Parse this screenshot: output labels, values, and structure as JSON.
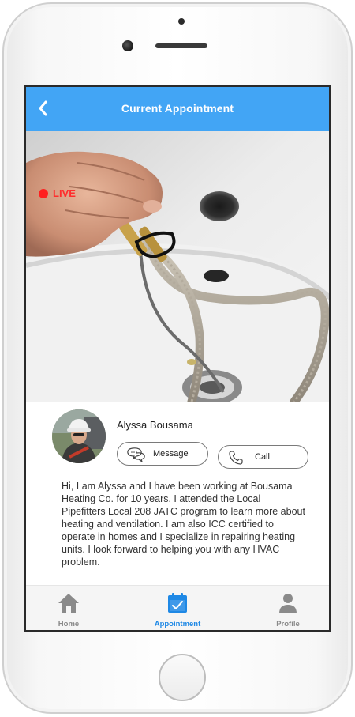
{
  "header": {
    "title": "Current Appointment"
  },
  "video": {
    "live_label": "LIVE"
  },
  "provider": {
    "name": "Alyssa Bousama",
    "message_label": "Message",
    "call_label": "Call",
    "bio": "Hi, I am Alyssa and I have been working at Bousama Heating Co. for 10 years. I attended the Local Pipefitters Local 208 JATC program to learn more about heating and ventilation. I am also ICC certified to operate in homes and I specialize in repairing heating units. I look forward to helping you with any HVAC problem."
  },
  "bottom_nav": {
    "items": [
      {
        "label": "Home",
        "icon": "home-icon",
        "active": false
      },
      {
        "label": "Appointment",
        "icon": "calendar-check-icon",
        "active": true
      },
      {
        "label": "Profile",
        "icon": "person-icon",
        "active": false
      }
    ]
  },
  "colors": {
    "brand_blue": "#42a5f5",
    "active_blue": "#1e88e5",
    "live_red": "#ff1f1f",
    "inactive_gray": "#8a8a8a"
  }
}
